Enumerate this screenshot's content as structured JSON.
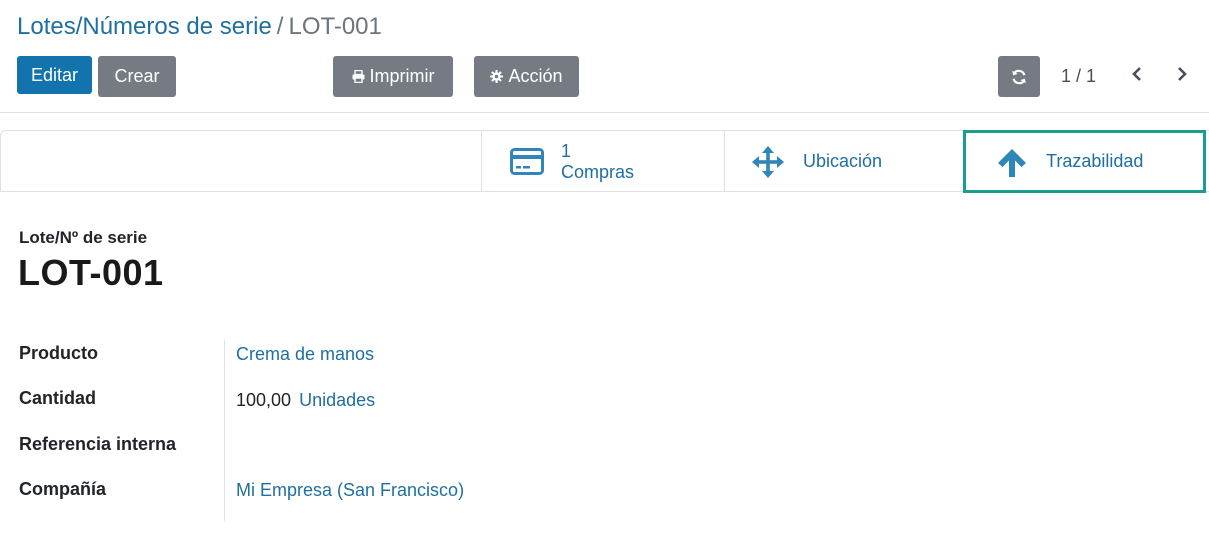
{
  "breadcrumb": {
    "parent": "Lotes/Números de serie",
    "separator": "/",
    "current": "LOT-001"
  },
  "toolbar": {
    "edit_label": "Editar",
    "create_label": "Crear",
    "print_label": "Imprimir",
    "print_icon": "printer-icon",
    "action_label": "Acción",
    "action_icon": "gear-icon",
    "refresh_icon": "refresh-icon"
  },
  "pager": {
    "value": "1 / 1",
    "prev_icon": "chevron-left-icon",
    "next_icon": "chevron-right-icon"
  },
  "smart_buttons": [
    {
      "icon": "credit-card-icon",
      "count": "1",
      "label": "Compras"
    },
    {
      "icon": "arrows-move-icon",
      "label": "Ubicación"
    },
    {
      "icon": "arrow-up-icon",
      "label": "Trazabilidad",
      "highlighted": true
    }
  ],
  "form": {
    "name_caption": "Lote/Nº de serie",
    "name": "LOT-001",
    "fields": {
      "product": {
        "label": "Producto",
        "value": "Crema de manos"
      },
      "quantity": {
        "label": "Cantidad",
        "value": "100,00",
        "uom": "Unidades"
      },
      "internal_ref": {
        "label": "Referencia interna",
        "value": ""
      },
      "company": {
        "label": "Compañía",
        "value": "Mi Empresa (San Francisco)"
      }
    }
  },
  "colors": {
    "primary": "#1273ad",
    "secondary": "#767a82",
    "link": "#1f6fa0",
    "highlight_border": "#1b9c93",
    "icon": "#2f86b8"
  }
}
